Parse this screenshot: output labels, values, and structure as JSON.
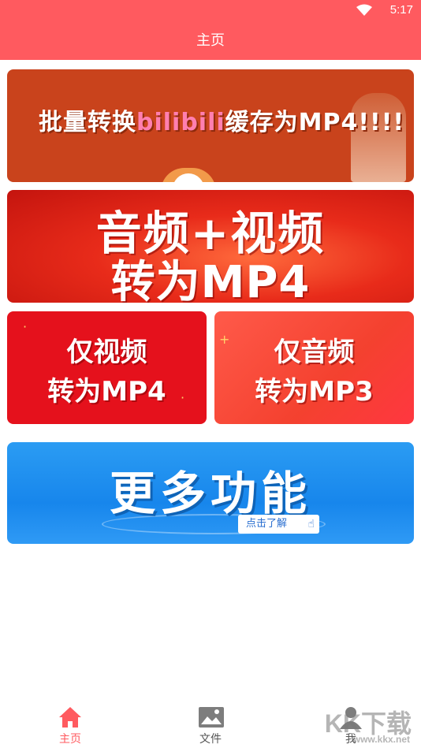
{
  "status_bar": {
    "time": "5:17",
    "wifi_icon": "wifi-icon"
  },
  "app_bar": {
    "title": "主页"
  },
  "banners": {
    "bilibili": {
      "prefix": "批量转换",
      "brand": "bilibili",
      "suffix": "缓存为MP4!!!!"
    },
    "audio_video": {
      "line1": "音频+视频",
      "line2": "转为MP4"
    },
    "video_only": {
      "line1": "仅视频",
      "line2": "转为MP4"
    },
    "audio_only": {
      "line1": "仅音频",
      "line2": "转为MP3"
    },
    "more": {
      "title": "更多功能",
      "cta": "点击了解"
    }
  },
  "tabs": [
    {
      "label": "主页",
      "icon": "home-icon",
      "active": true
    },
    {
      "label": "文件",
      "icon": "image-file-icon",
      "active": false
    },
    {
      "label": "我",
      "icon": "user-icon",
      "active": false
    }
  ],
  "watermark": {
    "main": "KK下载",
    "sub": "www.kkx.net"
  },
  "colors": {
    "primary": "#ff5a5f",
    "tab_inactive": "#555555"
  }
}
